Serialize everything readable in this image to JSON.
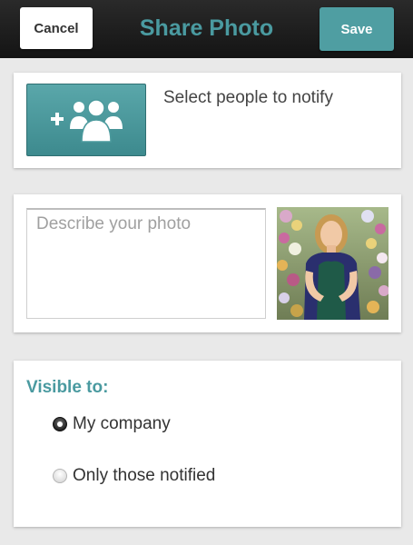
{
  "header": {
    "title": "Share Photo",
    "cancel_label": "Cancel",
    "save_label": "Save"
  },
  "notify": {
    "button_icon": "add-people-icon",
    "label": "Select people to notify"
  },
  "description": {
    "placeholder": "Describe your photo",
    "value": "",
    "thumbnail_icon": "photo-thumbnail"
  },
  "visibility": {
    "label": "Visible to:",
    "options": [
      {
        "label": "My company",
        "selected": true
      },
      {
        "label": "Only those notified",
        "selected": false
      }
    ]
  },
  "colors": {
    "accent": "#4a9aa0",
    "header_bg": "#1e1e1e",
    "page_bg": "#e9e9e9"
  }
}
